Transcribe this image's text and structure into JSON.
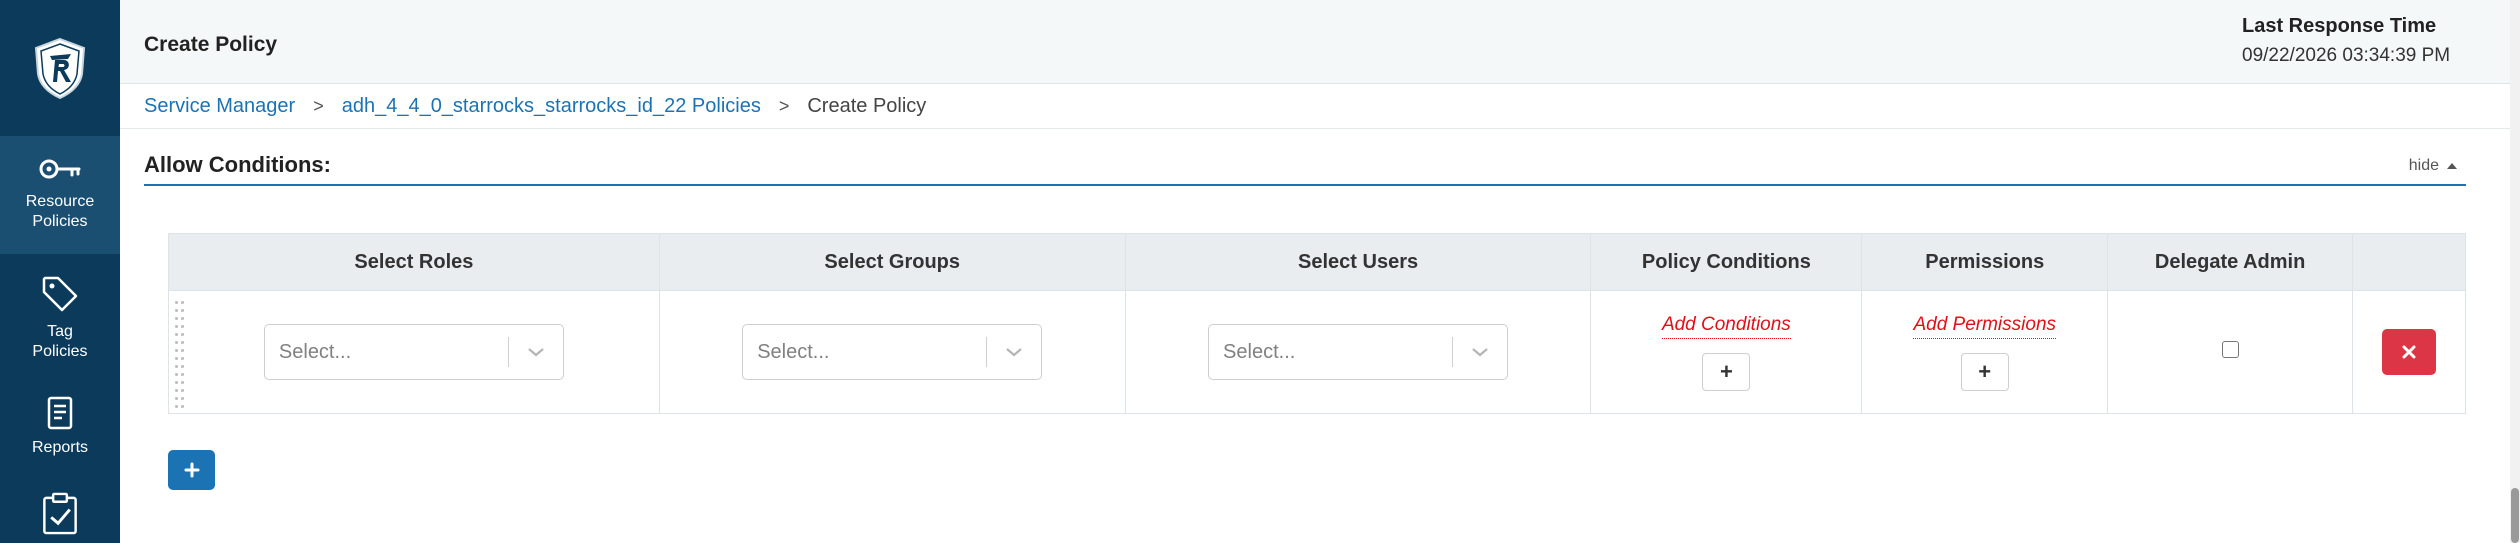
{
  "header": {
    "title": "Create Policy",
    "last_response_label": "Last Response Time",
    "last_response_value": "09/22/2026 03:34:39 PM"
  },
  "sidebar": {
    "items": [
      {
        "label_line1": "Resource",
        "label_line2": "Policies",
        "icon": "key-icon",
        "active": true
      },
      {
        "label_line1": "Tag",
        "label_line2": "Policies",
        "icon": "tag-icon"
      },
      {
        "label_line1": "Reports",
        "icon": "report-icon"
      },
      {
        "label_line1": "",
        "icon": "clipboard-check-icon"
      }
    ]
  },
  "breadcrumb": {
    "items": [
      "Service Manager",
      "adh_4_4_0_starrocks_starrocks_id_22 Policies"
    ],
    "current": "Create Policy",
    "separator": ">"
  },
  "section": {
    "title": "Allow Conditions:",
    "toggle_label": "hide"
  },
  "table": {
    "columns": [
      "Select Roles",
      "Select Groups",
      "Select Users",
      "Policy Conditions",
      "Permissions",
      "Delegate Admin"
    ],
    "row": {
      "roles_placeholder": "Select...",
      "groups_placeholder": "Select...",
      "users_placeholder": "Select...",
      "conditions_link": "Add Conditions",
      "permissions_link": "Add Permissions",
      "plus": "+",
      "delegate_admin": false
    }
  },
  "colors": {
    "sidebar_bg": "#0c3a5a",
    "accent": "#1b73b4",
    "danger": "#dc3545",
    "link_red": "#e0101a"
  }
}
